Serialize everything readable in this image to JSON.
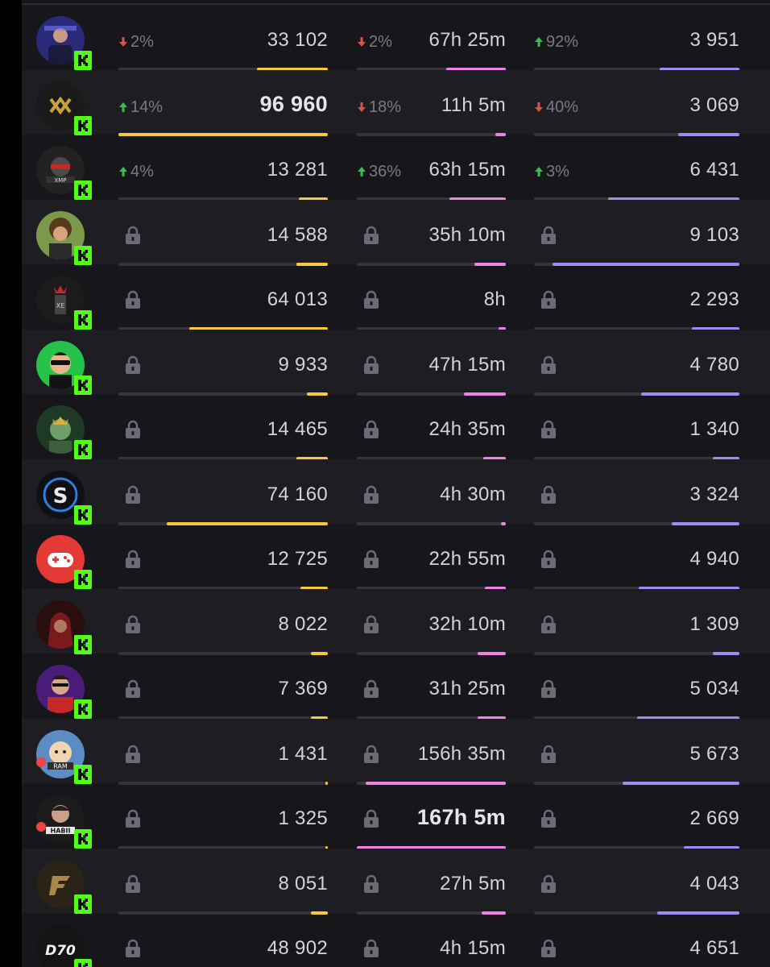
{
  "colors": {
    "views_bar": "#f5c842",
    "hours_bar": "#ef82e6",
    "followers_bar": "#9d8cf3",
    "up_arrow": "#3fb950",
    "down_arrow": "#d9534f",
    "kick_badge": "#53fc18"
  },
  "rows": [
    {
      "avatar": "purple-streamer-avatar",
      "live": false,
      "views": {
        "change": "2%",
        "dir": "down",
        "value": "33 102",
        "level": 0.34
      },
      "hours": {
        "change": "2%",
        "dir": "down",
        "value": "67h 25m",
        "level": 0.4
      },
      "followers": {
        "change": "92%",
        "dir": "up",
        "value": "3 951",
        "level": 0.39
      }
    },
    {
      "avatar": "gold-infinity-logo-avatar",
      "live": false,
      "views": {
        "change": "14%",
        "dir": "up",
        "value": "96 960",
        "level": 1.0,
        "highlight": true
      },
      "hours": {
        "change": "18%",
        "dir": "down",
        "value": "11h 5m",
        "level": 0.07
      },
      "followers": {
        "change": "40%",
        "dir": "down",
        "value": "3 069",
        "level": 0.3
      }
    },
    {
      "avatar": "red-masked-logo-avatar",
      "live": false,
      "views": {
        "change": "4%",
        "dir": "up",
        "value": "13 281",
        "level": 0.14
      },
      "hours": {
        "change": "36%",
        "dir": "up",
        "value": "63h 15m",
        "level": 0.38
      },
      "followers": {
        "change": "3%",
        "dir": "up",
        "value": "6 431",
        "level": 0.64
      }
    },
    {
      "avatar": "curly-hair-streamer-avatar",
      "live": false,
      "locked": true,
      "views": {
        "value": "14 588",
        "level": 0.15
      },
      "hours": {
        "value": "35h 10m",
        "level": 0.21
      },
      "followers": {
        "value": "9 103",
        "level": 0.91
      }
    },
    {
      "avatar": "dark-crown-logo-avatar",
      "live": false,
      "locked": true,
      "views": {
        "value": "64 013",
        "level": 0.66
      },
      "hours": {
        "value": "8h",
        "level": 0.05
      },
      "followers": {
        "value": "2 293",
        "level": 0.23
      }
    },
    {
      "avatar": "green-sunglasses-streamer-avatar",
      "live": false,
      "locked": true,
      "views": {
        "value": "9 933",
        "level": 0.1
      },
      "hours": {
        "value": "47h 15m",
        "level": 0.28
      },
      "followers": {
        "value": "4 780",
        "level": 0.48
      }
    },
    {
      "avatar": "king-crown-avatar",
      "live": false,
      "locked": true,
      "views": {
        "value": "14 465",
        "level": 0.15
      },
      "hours": {
        "value": "24h 35m",
        "level": 0.15
      },
      "followers": {
        "value": "1 340",
        "level": 0.13
      }
    },
    {
      "avatar": "blue-s-logo-avatar",
      "live": false,
      "locked": true,
      "views": {
        "value": "74 160",
        "level": 0.77
      },
      "hours": {
        "value": "4h 30m",
        "level": 0.03
      },
      "followers": {
        "value": "3 324",
        "level": 0.33
      }
    },
    {
      "avatar": "red-gamepad-logo-avatar",
      "live": false,
      "locked": true,
      "views": {
        "value": "12 725",
        "level": 0.13
      },
      "hours": {
        "value": "22h 55m",
        "level": 0.14
      },
      "followers": {
        "value": "4 940",
        "level": 0.49
      }
    },
    {
      "avatar": "red-hooded-streamer-avatar",
      "live": false,
      "locked": true,
      "views": {
        "value": "8 022",
        "level": 0.08
      },
      "hours": {
        "value": "32h 10m",
        "level": 0.19
      },
      "followers": {
        "value": "1 309",
        "level": 0.13
      }
    },
    {
      "avatar": "purple-glasses-streamer-avatar",
      "live": false,
      "locked": true,
      "views": {
        "value": "7 369",
        "level": 0.08
      },
      "hours": {
        "value": "31h 25m",
        "level": 0.19
      },
      "followers": {
        "value": "5 034",
        "level": 0.5
      }
    },
    {
      "avatar": "ram-cartoon-avatar",
      "live": true,
      "locked": true,
      "views": {
        "value": "1 431",
        "level": 0.01
      },
      "hours": {
        "value": "156h 35m",
        "level": 0.94
      },
      "followers": {
        "value": "5 673",
        "level": 0.57
      }
    },
    {
      "avatar": "habii-streamer-avatar",
      "live": true,
      "locked": true,
      "views": {
        "value": "1 325",
        "level": 0.01
      },
      "hours": {
        "value": "167h 5m",
        "level": 1.0,
        "highlight": true
      },
      "followers": {
        "value": "2 669",
        "level": 0.27
      }
    },
    {
      "avatar": "gold-f-logo-avatar",
      "live": false,
      "locked": true,
      "views": {
        "value": "8 051",
        "level": 0.08
      },
      "hours": {
        "value": "27h 5m",
        "level": 0.16
      },
      "followers": {
        "value": "4 043",
        "level": 0.4
      }
    },
    {
      "avatar": "d70-logo-avatar",
      "live": false,
      "locked": true,
      "views": {
        "value": "48 902",
        "level": 0.5
      },
      "hours": {
        "value": "4h 15m",
        "level": 0.03
      },
      "followers": {
        "value": "4 651",
        "level": 0.46
      }
    }
  ]
}
